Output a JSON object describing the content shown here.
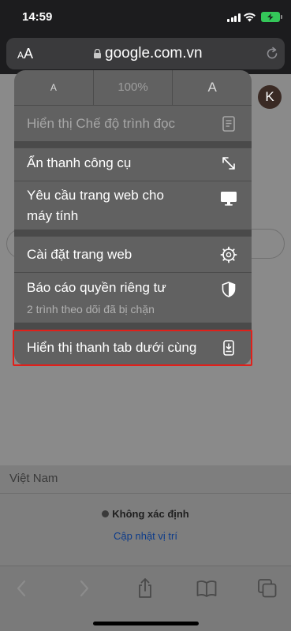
{
  "status_bar": {
    "time": "14:59"
  },
  "address_bar": {
    "text_size_small": "A",
    "text_size_large": "A",
    "url": "google.com.vn"
  },
  "page": {
    "avatar_letter": "K",
    "country": "Việt Nam",
    "location_status": "Không xác định",
    "location_update_link": "Cập nhật vị trí"
  },
  "menu": {
    "zoom": {
      "decrease": "A",
      "level": "100%",
      "increase": "A"
    },
    "reader_mode": "Hiển thị Chế độ trình đọc",
    "hide_toolbar": "Ẩn thanh công cụ",
    "request_desktop_line1": "Yêu cầu trang web cho",
    "request_desktop_line2": "máy tính",
    "website_settings": "Cài đặt trang web",
    "privacy_report": "Báo cáo quyền riêng tư",
    "privacy_report_sub": "2 trình theo dõi đã bị chặn",
    "show_bottom_tab_bar": "Hiển thị thanh tab dưới cùng"
  },
  "icons": {
    "lock": "lock-icon",
    "reload": "reload-icon",
    "reader": "document-icon",
    "expand": "expand-arrows-icon",
    "desktop": "desktop-icon",
    "settings": "gear-icon",
    "privacy": "shield-icon",
    "tab_bar": "bottom-tab-bar-icon",
    "back": "chevron-left-icon",
    "forward": "chevron-right-icon",
    "share": "share-icon",
    "bookmarks": "book-icon",
    "tabs": "tabs-icon"
  },
  "colors": {
    "highlight_box": "#e0201a",
    "battery": "#34c759",
    "link": "#0c3b8a"
  }
}
